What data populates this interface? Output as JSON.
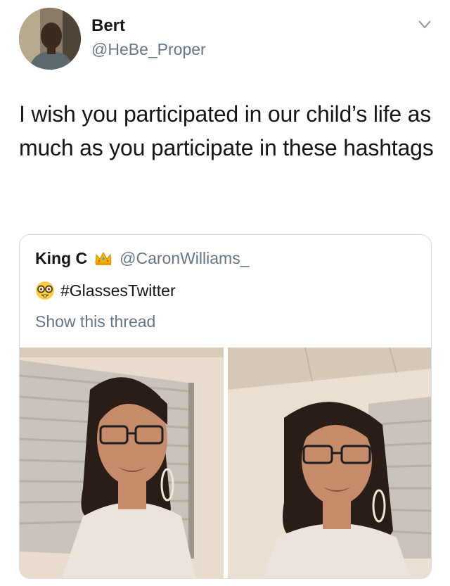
{
  "tweet": {
    "author_name": "Bert",
    "author_handle": "@HeBe_Proper",
    "text": "I wish you participated in our child’s life as much as you participate in these hashtags"
  },
  "quoted_tweet": {
    "author_name": "King C",
    "author_handle": "@CaronWilliams_",
    "text": "#GlassesTwitter",
    "show_thread_label": "Show this thread",
    "icons": [
      "crown-emoji",
      "nerd-face-emoji"
    ],
    "photo_count": 2
  },
  "icons": {
    "chevron": "chevron-down-icon"
  },
  "colors": {
    "text_primary": "#14171a",
    "text_secondary": "#657786",
    "card_border": "#d6dde3"
  }
}
